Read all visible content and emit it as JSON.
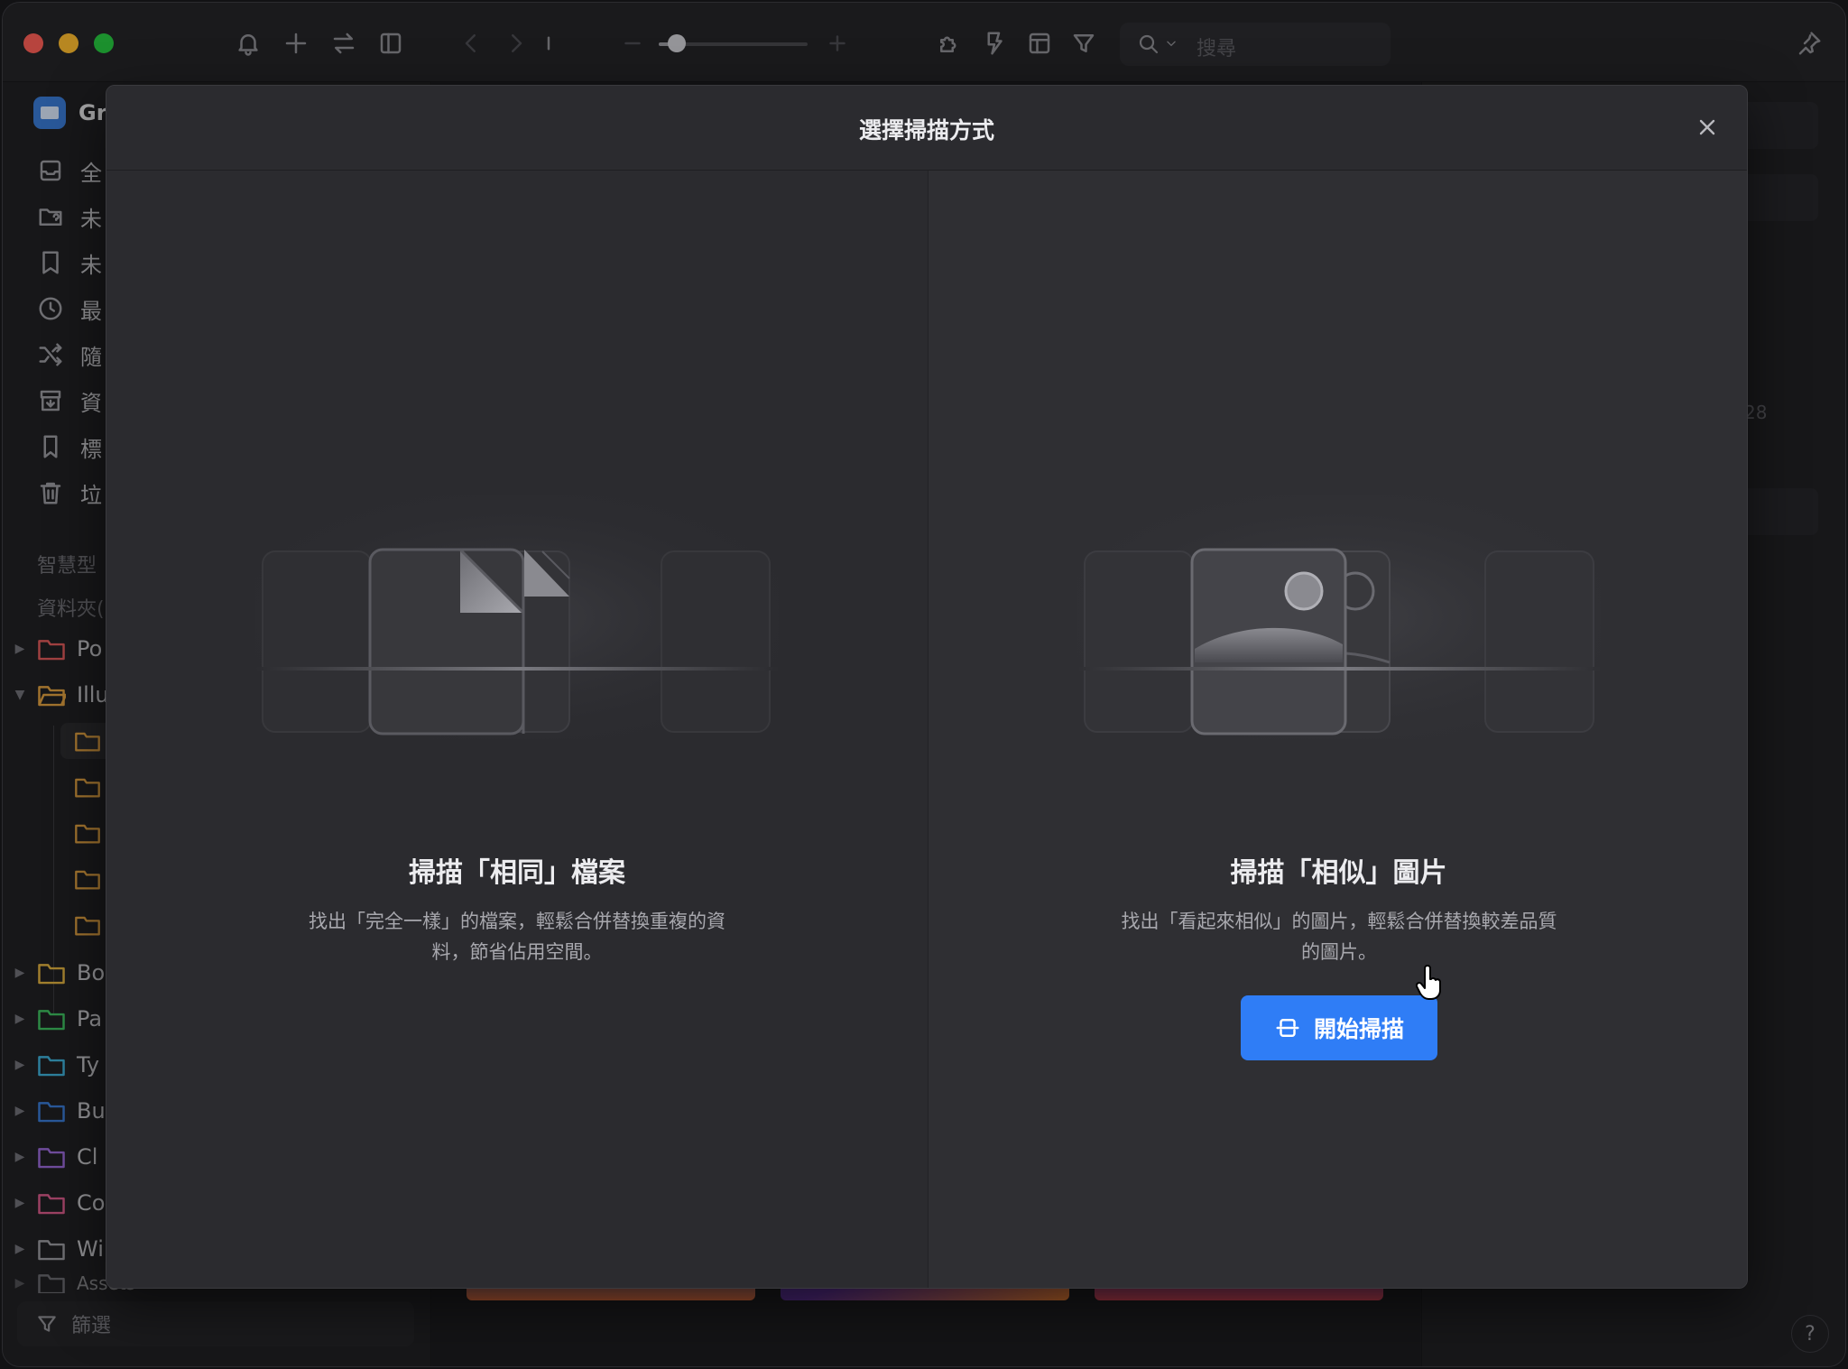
{
  "toolbar": {
    "icons": [
      "bell-icon",
      "plus-icon",
      "swap-icon",
      "sidebar-icon",
      "back-icon",
      "forward-icon",
      "zoom-out-icon",
      "zoom-in-icon",
      "plugin-icon",
      "action-icon",
      "layout-icon",
      "filter-icon",
      "search-icon",
      "pin-icon"
    ],
    "zoom_fraction": 0.12,
    "search": {
      "placeholder": "搜尋"
    }
  },
  "sidebar": {
    "library_name": "Gr",
    "items": [
      {
        "label": "全",
        "icon": "inbox-icon"
      },
      {
        "label": "未",
        "icon": "unfiled-icon"
      },
      {
        "label": "未",
        "icon": "untagged-icon"
      },
      {
        "label": "最",
        "icon": "clock-icon"
      },
      {
        "label": "隨",
        "icon": "shuffle-icon"
      },
      {
        "label": "資",
        "icon": "archive-icon"
      },
      {
        "label": "標",
        "icon": "bookmark-icon"
      },
      {
        "label": "垃",
        "icon": "trash-icon"
      }
    ],
    "section_smart": "智慧型",
    "section_folders": "資料夾(",
    "folders": [
      {
        "label": "Po",
        "color": "#e05a5a",
        "expanded": false
      },
      {
        "label": "Illu",
        "color": "#e0a040",
        "expanded": true
      },
      {
        "label": "Bo",
        "color": "#e0b040",
        "expanded": false
      },
      {
        "label": "Pa",
        "color": "#3fbf60",
        "expanded": false
      },
      {
        "label": "Ty",
        "color": "#3fb0d8",
        "expanded": false
      },
      {
        "label": "Bu",
        "color": "#3a7bd5",
        "expanded": false
      },
      {
        "label": "Cl",
        "color": "#9a6ad8",
        "expanded": false
      },
      {
        "label": "Co",
        "color": "#d85a8a",
        "expanded": false
      },
      {
        "label": "Wi",
        "color": "#9a9aa0",
        "expanded": false
      },
      {
        "label": "Assets",
        "color": "#9a9aa0",
        "expanded": false
      }
    ],
    "subfolder_color": "#e0a040",
    "filter_label": "篩選"
  },
  "right_panel": {
    "partial_number": "28"
  },
  "help_label": "?",
  "modal": {
    "title": "選擇掃描方式",
    "options": [
      {
        "title": "掃描「相同」檔案",
        "description": "找出「完全一樣」的檔案，輕鬆合併替換重複的資料，節省佔用空間。",
        "illustration": "duplicate-files"
      },
      {
        "title": "掃描「相似」圖片",
        "description": "找出「看起來相似」的圖片，輕鬆合併替換較差品質的圖片。",
        "illustration": "similar-images",
        "button_label": "開始掃描"
      }
    ]
  },
  "colors": {
    "accent": "#2f7df6",
    "modal_bg": "#2b2b2f",
    "window_bg": "#1e1e21"
  }
}
